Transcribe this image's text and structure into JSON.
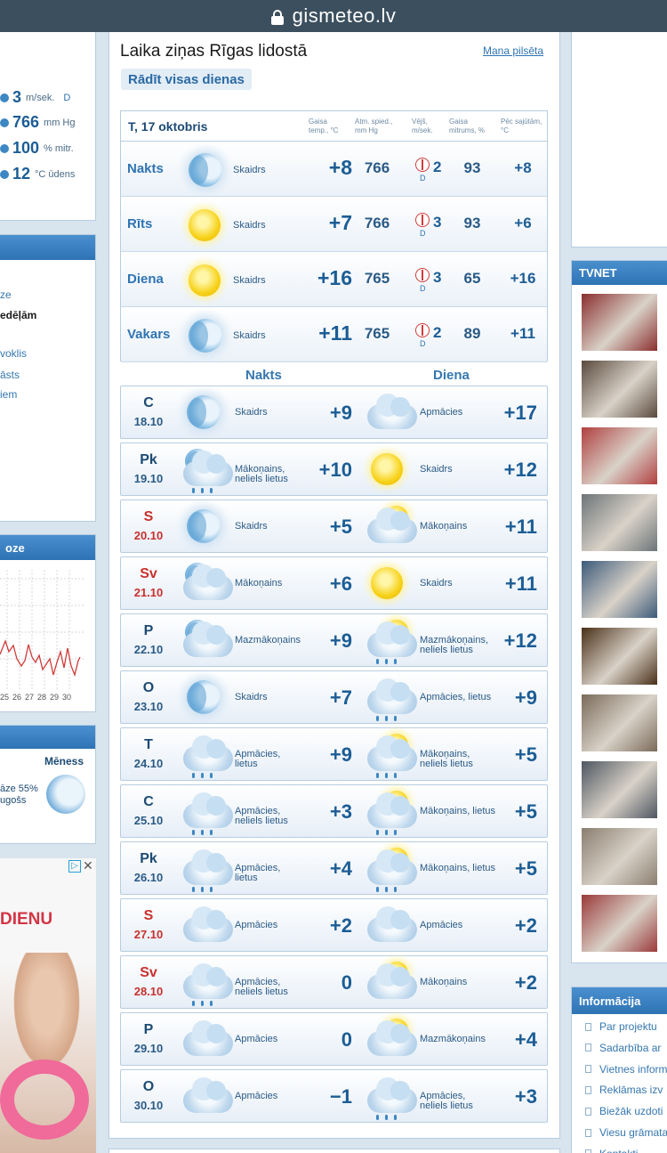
{
  "browser": {
    "url": "gismeteo.lv"
  },
  "left": {
    "current": [
      {
        "icon": "wind-arrow-icon",
        "value": "3",
        "unit": "m/sek.",
        "extra": "D"
      },
      {
        "icon": "pressure-gauge-icon",
        "value": "766",
        "unit": "mm Hg",
        "extra": ""
      },
      {
        "icon": "humidity-drop-icon",
        "value": "100",
        "unit": "% mitr.",
        "extra": ""
      },
      {
        "icon": "water-temp-icon",
        "value": "12",
        "unit": "°C ūdens",
        "extra": ""
      }
    ],
    "links": [
      "ze",
      "edēļām",
      "voklis",
      "āsts",
      "iem"
    ],
    "chart_head": "oze",
    "chart_ticks": [
      "25",
      "26",
      "27",
      "28",
      "29",
      "30"
    ],
    "moon_label": "Mēness",
    "moon_line1": "āze 55%",
    "moon_line2": "ugošs",
    "ad_title": "DIENU"
  },
  "main": {
    "title": "Laika ziņas Rīgas lidostā",
    "my_city": "Mana pilsēta",
    "show_all": "Rādīt visas dienas",
    "today": {
      "date": "T, 17 oktobris",
      "col_headers": {
        "temp": "Gaisa temp., °C",
        "pressure": "Atm. spied., mm Hg",
        "wind": "Vējš, m/sek.",
        "humidity": "Gaisa mitrums, %",
        "feels": "Pēc sajūtām, °C"
      },
      "rows": [
        {
          "period": "Nakts",
          "icon": "moon",
          "desc": "Skaidrs",
          "temp": "+8",
          "pressure": "766",
          "wind": "2",
          "dir": "D",
          "humidity": "93",
          "feels": "+8"
        },
        {
          "period": "Rīts",
          "icon": "sun",
          "desc": "Skaidrs",
          "temp": "+7",
          "pressure": "766",
          "wind": "3",
          "dir": "D",
          "humidity": "93",
          "feels": "+6"
        },
        {
          "period": "Diena",
          "icon": "sun",
          "desc": "Skaidrs",
          "temp": "+16",
          "pressure": "765",
          "wind": "3",
          "dir": "D",
          "humidity": "65",
          "feels": "+16"
        },
        {
          "period": "Vakars",
          "icon": "moon",
          "desc": "Skaidrs",
          "temp": "+11",
          "pressure": "765",
          "wind": "2",
          "dir": "D",
          "humidity": "89",
          "feels": "+11"
        }
      ]
    },
    "night_label": "Nakts",
    "day_label": "Diena",
    "days": [
      {
        "dow": "C",
        "date": "18.10",
        "weekend": false,
        "n_icon": "moon",
        "n_desc": "Skaidrs",
        "n_temp": "+9",
        "d_icon": "cloud",
        "d_desc": "Apmācies",
        "d_temp": "+17"
      },
      {
        "dow": "Pk",
        "date": "19.10",
        "weekend": false,
        "n_icon": "moon-cloud-rain",
        "n_desc": "Mākoņains, neliels lietus",
        "n_temp": "+10",
        "d_icon": "sun",
        "d_desc": "Skaidrs",
        "d_temp": "+12"
      },
      {
        "dow": "S",
        "date": "20.10",
        "weekend": true,
        "n_icon": "moon",
        "n_desc": "Skaidrs",
        "n_temp": "+5",
        "d_icon": "sun-cloud",
        "d_desc": "Mākoņains",
        "d_temp": "+11"
      },
      {
        "dow": "Sv",
        "date": "21.10",
        "weekend": true,
        "n_icon": "moon-cloud",
        "n_desc": "Mākoņains",
        "n_temp": "+6",
        "d_icon": "sun",
        "d_desc": "Skaidrs",
        "d_temp": "+11"
      },
      {
        "dow": "P",
        "date": "22.10",
        "weekend": false,
        "n_icon": "moon-cloud",
        "n_desc": "Mazmākoņains",
        "n_temp": "+9",
        "d_icon": "sun-cloud-rain",
        "d_desc": "Mazmākoņains, neliels lietus",
        "d_temp": "+12"
      },
      {
        "dow": "O",
        "date": "23.10",
        "weekend": false,
        "n_icon": "moon",
        "n_desc": "Skaidrs",
        "n_temp": "+7",
        "d_icon": "cloud-rain",
        "d_desc": "Apmācies, lietus",
        "d_temp": "+9"
      },
      {
        "dow": "T",
        "date": "24.10",
        "weekend": false,
        "n_icon": "cloud-rain",
        "n_desc": "Apmācies, lietus",
        "n_temp": "+9",
        "d_icon": "sun-cloud-rain",
        "d_desc": "Mākoņains, neliels lietus",
        "d_temp": "+5"
      },
      {
        "dow": "C",
        "date": "25.10",
        "weekend": false,
        "n_icon": "cloud-rain",
        "n_desc": "Apmācies, neliels lietus",
        "n_temp": "+3",
        "d_icon": "sun-cloud-rain",
        "d_desc": "Mākoņains, lietus",
        "d_temp": "+5"
      },
      {
        "dow": "Pk",
        "date": "26.10",
        "weekend": false,
        "n_icon": "cloud-rain",
        "n_desc": "Apmācies, lietus",
        "n_temp": "+4",
        "d_icon": "sun-cloud-rain",
        "d_desc": "Mākoņains, lietus",
        "d_temp": "+5"
      },
      {
        "dow": "S",
        "date": "27.10",
        "weekend": true,
        "n_icon": "cloud",
        "n_desc": "Apmācies",
        "n_temp": "+2",
        "d_icon": "cloud",
        "d_desc": "Apmācies",
        "d_temp": "+2"
      },
      {
        "dow": "Sv",
        "date": "28.10",
        "weekend": true,
        "n_icon": "cloud-rain",
        "n_desc": "Apmācies, neliels lietus",
        "n_temp": "0",
        "d_icon": "sun-cloud",
        "d_desc": "Mākoņains",
        "d_temp": "+2"
      },
      {
        "dow": "P",
        "date": "29.10",
        "weekend": false,
        "n_icon": "cloud",
        "n_desc": "Apmācies",
        "n_temp": "0",
        "d_icon": "sun-cloud",
        "d_desc": "Mazmākoņains",
        "d_temp": "+4"
      },
      {
        "dow": "O",
        "date": "30.10",
        "weekend": false,
        "n_icon": "cloud",
        "n_desc": "Apmācies",
        "n_temp": "−1",
        "d_icon": "cloud-rain",
        "d_desc": "Apmācies, neliels lietus",
        "d_temp": "+3"
      }
    ]
  },
  "right": {
    "tvnet_title": "TVNET",
    "thumb_colors": [
      "#8a2e2e",
      "#5a4a3e",
      "#b04040",
      "#6c7478",
      "#3c5a7a",
      "#4a3018",
      "#7a6a5a",
      "#4e5660",
      "#8a7e70",
      "#9a3a3a"
    ],
    "info_title": "Informācija",
    "info_links": [
      "Par projektu",
      "Sadarbība ar",
      "Vietnes inform",
      "Reklāmas izv",
      "Biežāk uzdoti",
      "Viesu grāmata",
      "Kontakti"
    ]
  }
}
